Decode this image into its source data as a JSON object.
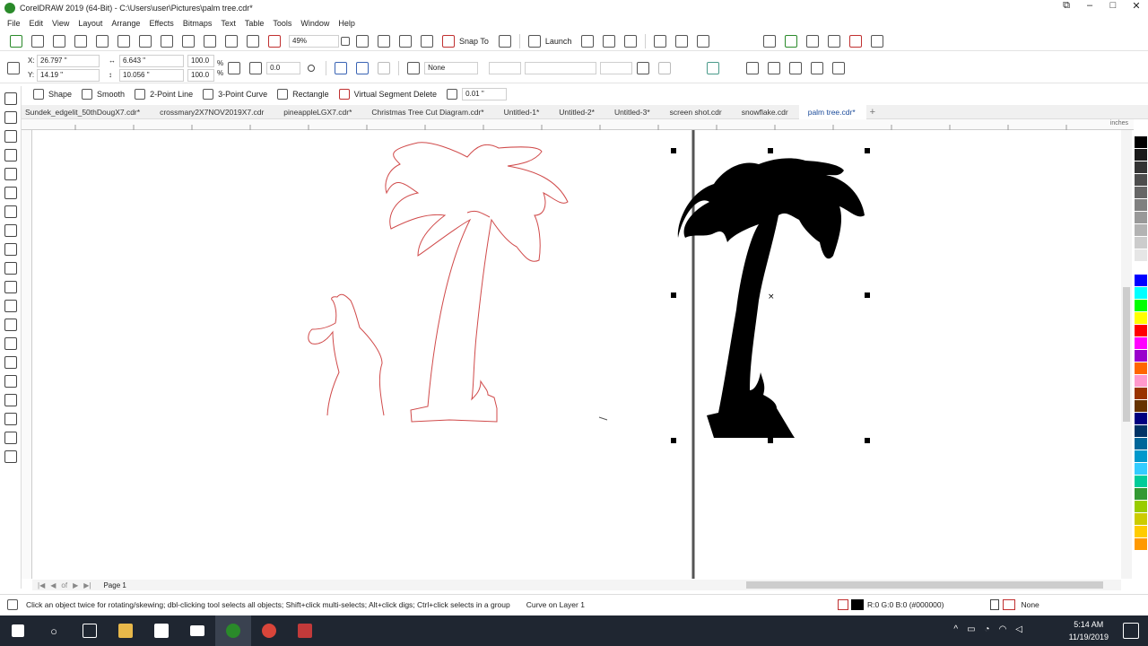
{
  "app": {
    "title": "CorelDRAW 2019 (64-Bit) - C:\\Users\\user\\Pictures\\palm tree.cdr*"
  },
  "menu": [
    "File",
    "Edit",
    "View",
    "Layout",
    "Arrange",
    "Effects",
    "Bitmaps",
    "Text",
    "Table",
    "Tools",
    "Window",
    "Help"
  ],
  "standard_toolbar": {
    "zoom": "49%",
    "snap_to": "Snap To",
    "launch": "Launch"
  },
  "property_bar": {
    "x": "26.797 \"",
    "y": "14.19 \"",
    "width": "6.643 \"",
    "height": "10.056 \"",
    "scale_x": "100.0",
    "scale_y": "100.0",
    "pct": "%",
    "angle": "0.0",
    "outline": "None"
  },
  "shape_toolbar": {
    "shape": "Shape",
    "smooth": "Smooth",
    "two_point_line": "2-Point Line",
    "three_point_curve": "3-Point Curve",
    "rectangle": "Rectangle",
    "virtual_segment_delete": "Virtual Segment Delete",
    "nudge": "0.01 \""
  },
  "tabs": [
    "Sundek_edgelit_50thDougX7.cdr*",
    "crossmary2X7NOV2019X7.cdr",
    "pineappleLGX7.cdr*",
    "Christmas Tree Cut Diagram.cdr*",
    "Untitled-1*",
    "Untitled-2*",
    "Untitled-3*",
    "screen shot.cdr",
    "snowflake.cdr",
    "palm tree.cdr*"
  ],
  "ruler": {
    "unit": "inches"
  },
  "page_nav": {
    "page_of": "of",
    "page_label": "Page 1"
  },
  "status": {
    "hint": "Click an object twice for rotating/skewing; dbl-clicking tool selects all objects; Shift+click multi-selects; Alt+click digs; Ctrl+click selects in a group",
    "object_info": "Curve on Layer 1",
    "fill": "R:0 G:0 B:0 (#000000)",
    "outline": "None"
  },
  "taskbar": {
    "time": "5:14 AM",
    "date": "11/19/2019"
  },
  "colors": {
    "outline_red": "#d04a4a",
    "fill_black": "#000000"
  },
  "palette": [
    "#ffffff",
    "#000000",
    "#1a1a1a",
    "#333333",
    "#4d4d4d",
    "#666666",
    "#808080",
    "#999999",
    "#b3b3b3",
    "#cccccc",
    "#e6e6e6",
    "#ffffff",
    "#0000ff",
    "#00ffff",
    "#00ff00",
    "#ffff00",
    "#ff0000",
    "#ff00ff",
    "#9900cc",
    "#ff6600",
    "#ff99cc",
    "#993300",
    "#663300",
    "#000080",
    "#003366",
    "#006699",
    "#0099cc",
    "#33ccff",
    "#00cc99",
    "#339933",
    "#99cc00",
    "#cccc00",
    "#ffcc00",
    "#ff9900"
  ]
}
